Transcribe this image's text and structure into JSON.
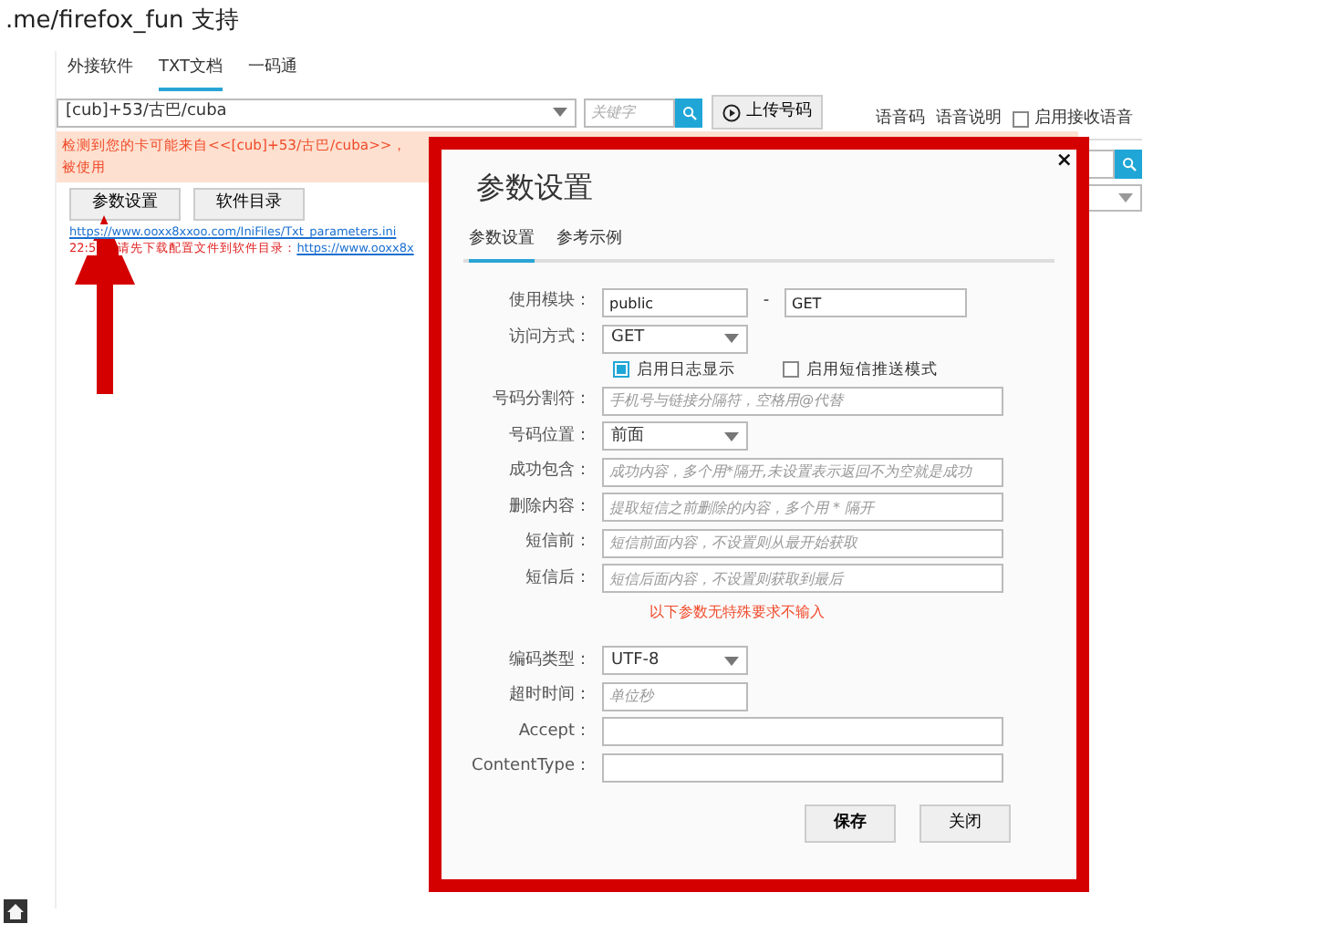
{
  "page_title": ".me/firefox_fun 支持",
  "tabs": [
    {
      "label": "外接软件",
      "selected": false
    },
    {
      "label": "TXT文档",
      "selected": true
    },
    {
      "label": "一码通",
      "selected": false
    }
  ],
  "country_select": {
    "value": "[cub]+53/古巴/cuba"
  },
  "keyword_search": {
    "placeholder": "关键字"
  },
  "upload_button": "上传号码",
  "voice_links": [
    "语音码",
    "语音说明"
  ],
  "voice_checkbox": {
    "label": "启用接收语音",
    "checked": false
  },
  "warning": [
    "检测到您的卡可能来自<<[cub]+53/古巴/cuba>>，",
    "被使用"
  ],
  "buttons": [
    "参数设置",
    "软件目录"
  ],
  "log": {
    "link": "https://www.ooxx8xxoo.com/IniFiles/Txt_parameters.ini",
    "time": "22:5",
    "message": "请先下载配置文件到软件目录：",
    "link2": "https://www.ooxx8x"
  },
  "dialog": {
    "title": "参数设置",
    "close": "×",
    "tabs": [
      {
        "label": "参数设置",
        "selected": true
      },
      {
        "label": "参考示例",
        "selected": false
      }
    ],
    "rows": [
      {
        "kind": "pair",
        "label": "使用模块：",
        "value": "public",
        "separator": "-",
        "value2": "GET"
      },
      {
        "kind": "select",
        "label": "访问方式：",
        "value": "GET"
      },
      {
        "kind": "checks",
        "items": [
          {
            "label": "启用日志显示",
            "checked": true
          },
          {
            "label": "启用短信推送模式",
            "checked": false
          }
        ]
      },
      {
        "kind": "input",
        "label": "号码分割符：",
        "placeholder": "手机号与链接分隔符，空格用@代替"
      },
      {
        "kind": "select",
        "label": "号码位置：",
        "value": "前面"
      },
      {
        "kind": "input",
        "label": "成功包含：",
        "placeholder": "成功内容，多个用*隔开,未设置表示返回不为空就是成功"
      },
      {
        "kind": "input",
        "label": "删除内容：",
        "placeholder": "提取短信之前删除的内容，多个用 * 隔开"
      },
      {
        "kind": "input",
        "label": "短信前：",
        "placeholder": "短信前面内容，不设置则从最开始获取"
      },
      {
        "kind": "input",
        "label": "短信后：",
        "placeholder": "短信后面内容，不设置则获取到最后"
      },
      {
        "kind": "note",
        "text": "以下参数无特殊要求不输入"
      },
      {
        "kind": "select",
        "label": "编码类型：",
        "value": "UTF-8"
      },
      {
        "kind": "short_input",
        "label": "超时时间：",
        "placeholder": "单位秒"
      },
      {
        "kind": "input",
        "label": "Accept："
      },
      {
        "kind": "input",
        "label": "ContentType："
      }
    ],
    "buttons": [
      {
        "label": "保存",
        "primary": true
      },
      {
        "label": "关闭",
        "primary": false
      }
    ]
  }
}
